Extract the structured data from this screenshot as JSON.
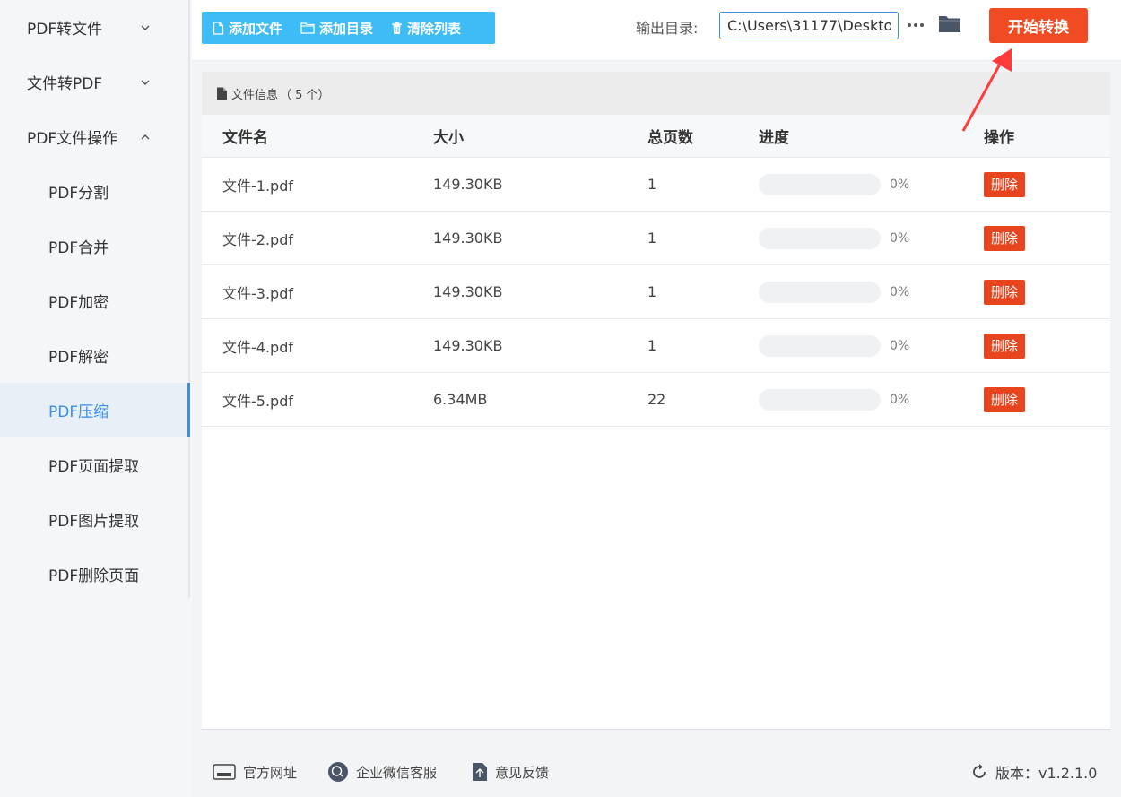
{
  "sidebar": {
    "groups": [
      {
        "label": "PDF转文件",
        "expanded": false
      },
      {
        "label": "文件转PDF",
        "expanded": false
      },
      {
        "label": "PDF文件操作",
        "expanded": true
      }
    ],
    "items": [
      {
        "label": "PDF分割"
      },
      {
        "label": "PDF合并"
      },
      {
        "label": "PDF加密"
      },
      {
        "label": "PDF解密"
      },
      {
        "label": "PDF压缩",
        "active": true
      },
      {
        "label": "PDF页面提取"
      },
      {
        "label": "PDF图片提取"
      },
      {
        "label": "PDF删除页面"
      }
    ]
  },
  "toolbar": {
    "add_file_label": "添加文件",
    "add_dir_label": "添加目录",
    "clear_label": "清除列表",
    "output_label": "输出目录:",
    "output_value": "C:\\Users\\31177\\Deskto",
    "start_label": "开始转换"
  },
  "panel": {
    "header_label": "文件信息",
    "header_count": "（ 5 个）",
    "columns": {
      "name": "文件名",
      "size": "大小",
      "pages": "总页数",
      "progress": "进度",
      "op": "操作"
    },
    "rows": [
      {
        "name": "文件-1.pdf",
        "size": "149.30KB",
        "pages": "1",
        "progress": 0,
        "progress_text": "0%",
        "op": "删除"
      },
      {
        "name": "文件-2.pdf",
        "size": "149.30KB",
        "pages": "1",
        "progress": 0,
        "progress_text": "0%",
        "op": "删除"
      },
      {
        "name": "文件-3.pdf",
        "size": "149.30KB",
        "pages": "1",
        "progress": 0,
        "progress_text": "0%",
        "op": "删除"
      },
      {
        "name": "文件-4.pdf",
        "size": "149.30KB",
        "pages": "1",
        "progress": 0,
        "progress_text": "0%",
        "op": "删除"
      },
      {
        "name": "文件-5.pdf",
        "size": "6.34MB",
        "pages": "22",
        "progress": 0,
        "progress_text": "0%",
        "op": "删除"
      }
    ]
  },
  "footer": {
    "website_label": "官方网址",
    "wechat_label": "企业微信客服",
    "feedback_label": "意见反馈",
    "version_label": "版本：v1.2.1.0"
  },
  "colors": {
    "accent": "#3ebcf5",
    "start": "#f04b23",
    "delete": "#e8451e",
    "active_nav": "#3a8ee6"
  }
}
